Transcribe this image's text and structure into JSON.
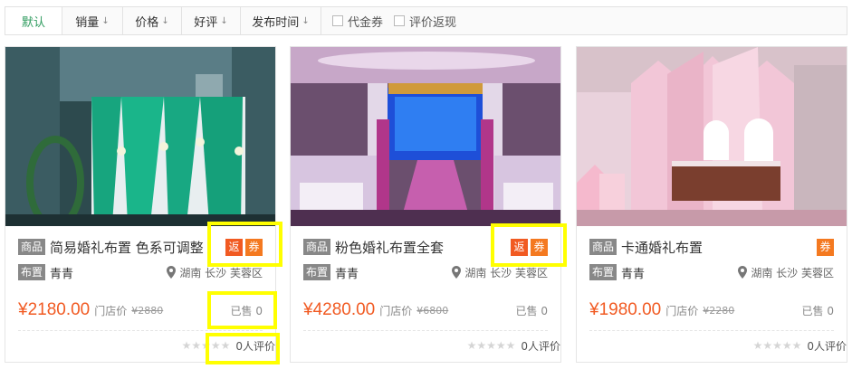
{
  "sortbar": {
    "items": [
      {
        "label": "默认",
        "active": true
      },
      {
        "label": "销量",
        "arrow": "↓"
      },
      {
        "label": "价格",
        "arrow": "↓"
      },
      {
        "label": "好评",
        "arrow": "↓"
      },
      {
        "label": "发布时间",
        "arrow": "↓"
      }
    ],
    "checks": [
      {
        "label": "代金券"
      },
      {
        "label": "评价返现"
      }
    ]
  },
  "cards": [
    {
      "tag": "商品",
      "title": "简易婚礼布置 色系可调整",
      "badges": {
        "fan": "返",
        "quan": "券"
      },
      "shop_tag": "布置",
      "shop": "青青",
      "location": "湖南 长沙 芙蓉区",
      "price": "¥2180.00",
      "store_label": "门店价",
      "orig_price": "¥2880",
      "sold": "已售 0",
      "stars": "★★★★★",
      "reviews": "0人评价"
    },
    {
      "tag": "商品",
      "title": "粉色婚礼布置全套",
      "badges": {
        "fan": "返",
        "quan": "券"
      },
      "shop_tag": "布置",
      "shop": "青青",
      "location": "湖南 长沙 芙蓉区",
      "price": "¥4280.00",
      "store_label": "门店价",
      "orig_price": "¥6800",
      "sold": "已售 0",
      "stars": "★★★★★",
      "reviews": "0人评价"
    },
    {
      "tag": "商品",
      "title": "卡通婚礼布置",
      "badges": {
        "quan": "券"
      },
      "shop_tag": "布置",
      "shop": "青青",
      "location": "湖南 长沙 芙蓉区",
      "price": "¥1980.00",
      "store_label": "门店价",
      "orig_price": "¥2280",
      "sold": "已售 0",
      "stars": "★★★★★",
      "reviews": "0人评价"
    }
  ],
  "colors": {
    "accent_green": "#2e9b5e",
    "price_orange": "#f15a22",
    "highlight": "#ffff00"
  },
  "images": {
    "card1": "green-white-drape-wedding-stage",
    "card2": "purple-banquet-hall-stage-with-led-screen",
    "card3": "pink-castle-wedding-backdrop"
  }
}
